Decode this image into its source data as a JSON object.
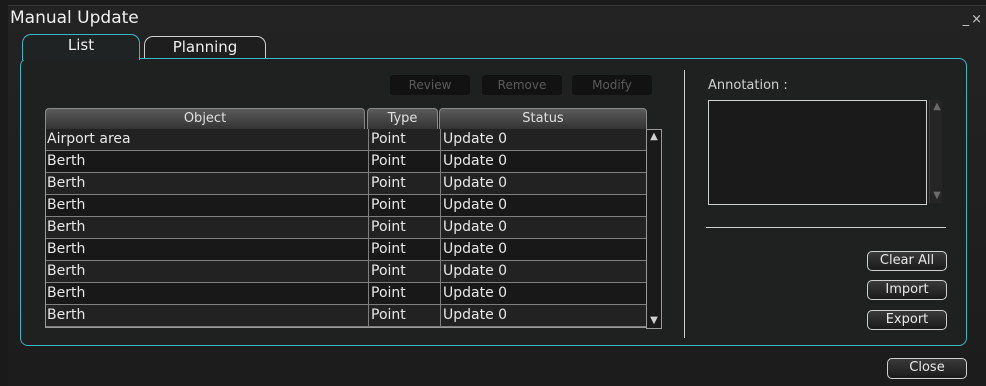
{
  "window": {
    "title": "Manual Update",
    "minimize": "_",
    "close_glyph": "×"
  },
  "tabs": [
    {
      "label": "List",
      "active": true
    },
    {
      "label": "Planning",
      "active": false
    }
  ],
  "toolbar": {
    "review": "Review",
    "remove": "Remove",
    "modify": "Modify"
  },
  "table": {
    "headers": [
      "Object",
      "Type",
      "Status"
    ],
    "rows": [
      {
        "object": "Airport area",
        "type": "Point",
        "status": "Update 0"
      },
      {
        "object": "Berth",
        "type": "Point",
        "status": "Update 0"
      },
      {
        "object": "Berth",
        "type": "Point",
        "status": "Update 0"
      },
      {
        "object": "Berth",
        "type": "Point",
        "status": "Update 0"
      },
      {
        "object": "Berth",
        "type": "Point",
        "status": "Update 0"
      },
      {
        "object": "Berth",
        "type": "Point",
        "status": "Update 0"
      },
      {
        "object": "Berth",
        "type": "Point",
        "status": "Update 0"
      },
      {
        "object": "Berth",
        "type": "Point",
        "status": "Update 0"
      },
      {
        "object": "Berth",
        "type": "Point",
        "status": "Update 0"
      }
    ]
  },
  "annotation": {
    "label": "Annotation :",
    "value": ""
  },
  "actions": {
    "clear_all": "Clear All",
    "import": "Import",
    "export": "Export",
    "close": "Close"
  },
  "icons": {
    "scroll_up": "scroll-up-icon",
    "scroll_down": "scroll-down-icon"
  },
  "colors": {
    "accent": "#38b8c4",
    "background": "#1a1a1a"
  }
}
